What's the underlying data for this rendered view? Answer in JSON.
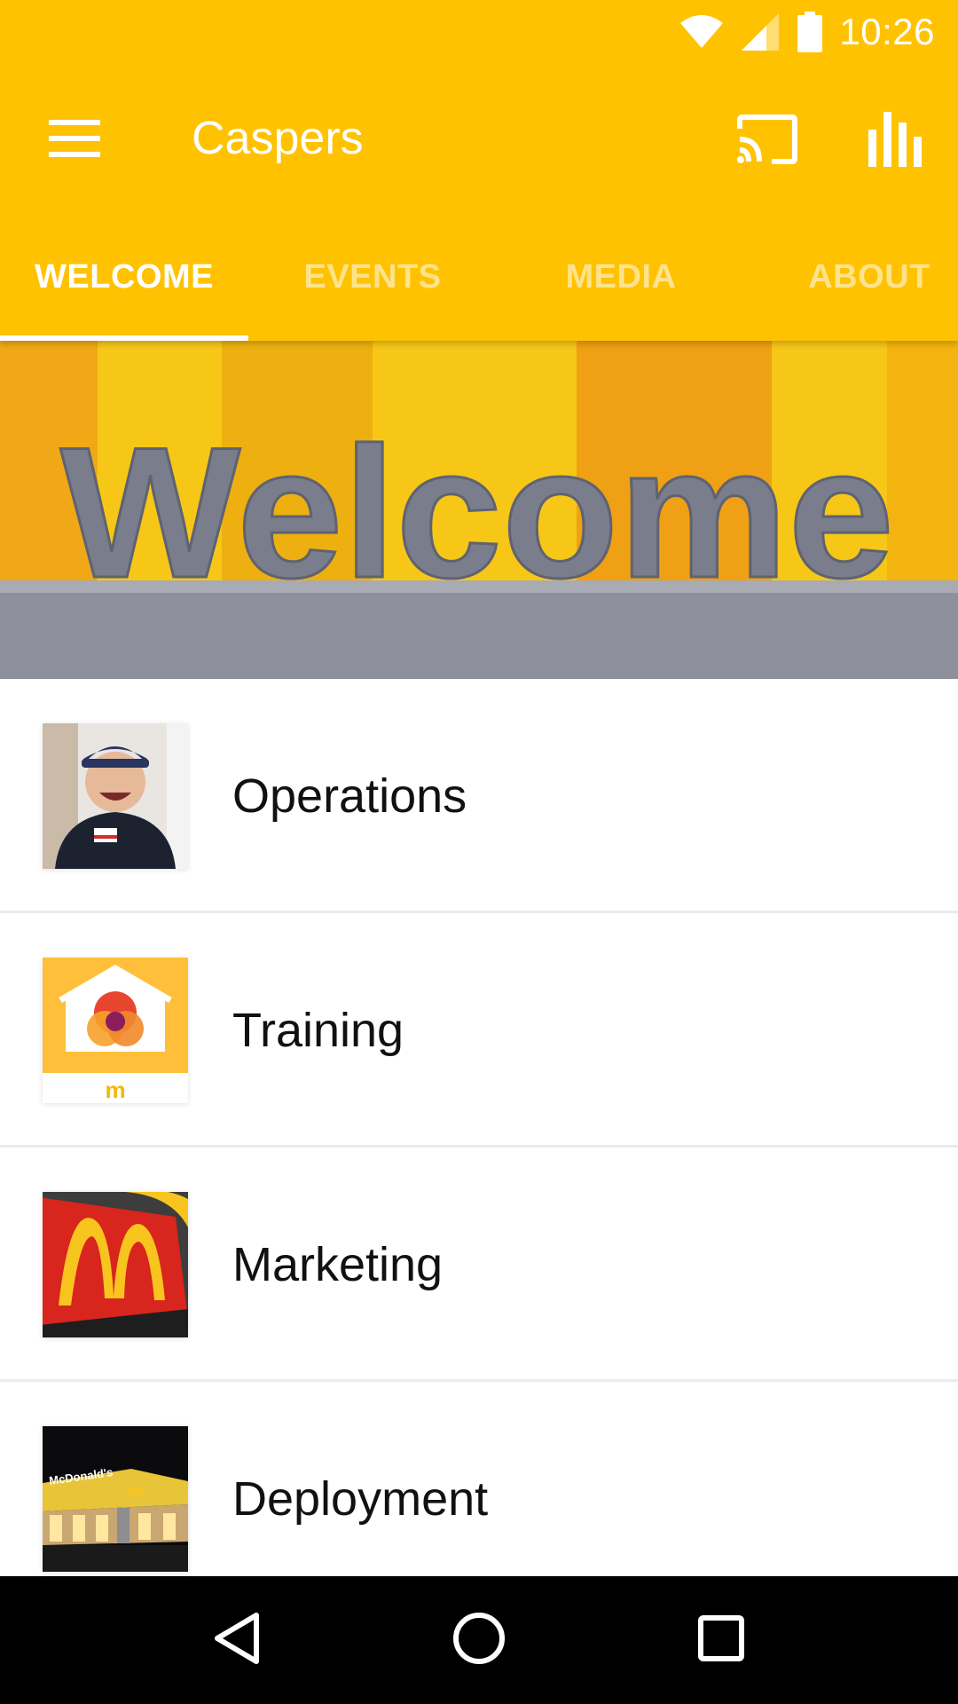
{
  "status_bar": {
    "time": "10:26",
    "icons": [
      "wifi-icon",
      "cell-signal-icon",
      "battery-icon"
    ]
  },
  "app_bar": {
    "title": "Caspers",
    "menu_icon": "hamburger-menu-icon",
    "actions": [
      "cast-icon",
      "bar-chart-icon"
    ]
  },
  "tabs": [
    {
      "label": "WELCOME",
      "active": true
    },
    {
      "label": "EVENTS",
      "active": false
    },
    {
      "label": "MEDIA",
      "active": false
    },
    {
      "label": "ABOUT",
      "active": false
    }
  ],
  "hero": {
    "text": "Welcome"
  },
  "list": {
    "items": [
      {
        "label": "Operations",
        "icon": "employee-photo"
      },
      {
        "label": "Training",
        "icon": "training-house-logo"
      },
      {
        "label": "Marketing",
        "icon": "golden-arches-sign"
      },
      {
        "label": "Deployment",
        "icon": "restaurant-night-photo"
      }
    ]
  },
  "training_thumb": {
    "logo_text": "m"
  },
  "deployment_thumb": {
    "sign_text": "McDonald's"
  },
  "nav_bar": {
    "buttons": [
      "back-icon",
      "home-icon",
      "recents-icon"
    ]
  },
  "colors": {
    "primary": "#FFC200",
    "tab_inactive": "rgba(255,255,255,0.55)",
    "text": "#111111",
    "divider": "#EBEBEB"
  }
}
